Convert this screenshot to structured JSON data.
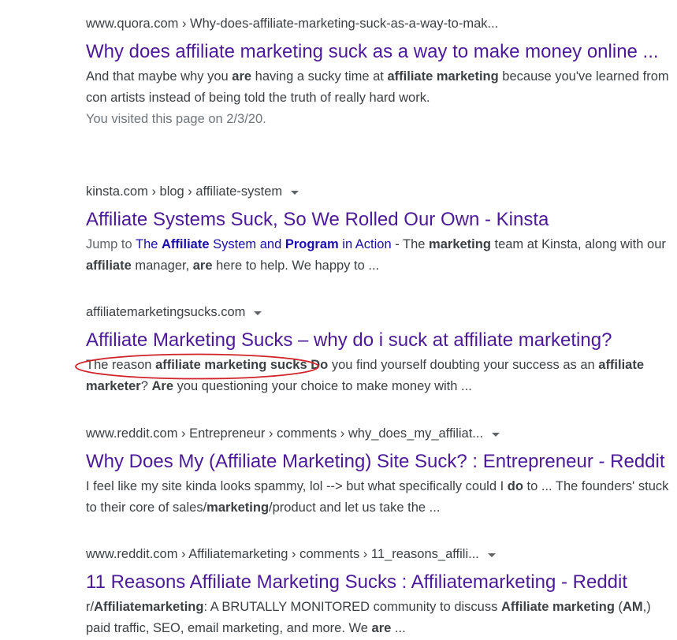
{
  "results": [
    {
      "cite": "www.quora.com › Why-does-affiliate-marketing-suck-as-a-way-to-mak...",
      "title": "Why does affiliate marketing suck as a way to make money online ...",
      "snippet": [
        {
          "t": "And that maybe why you "
        },
        {
          "t": "are",
          "b": true
        },
        {
          "t": " having a sucky time at "
        },
        {
          "t": "affiliate marketing",
          "b": true
        },
        {
          "t": " because you've learned from con artists instead of being told the truth of really hard work."
        }
      ],
      "visited": "You visited this page on 2/3/20."
    },
    {
      "cite": "kinsta.com › blog › affiliate-system",
      "title": "Affiliate Systems Suck, So We Rolled Our Own - Kinsta",
      "jump_prefix": "Jump to ",
      "jump_link": [
        {
          "t": "The "
        },
        {
          "t": "Affiliate",
          "b": true
        },
        {
          "t": " System and "
        },
        {
          "t": "Program",
          "b": true
        },
        {
          "t": " in Action"
        }
      ],
      "snippet": [
        {
          "t": " - The "
        },
        {
          "t": "marketing",
          "b": true
        },
        {
          "t": " team at Kinsta, along with our "
        },
        {
          "t": "affiliate",
          "b": true
        },
        {
          "t": " manager, "
        },
        {
          "t": "are",
          "b": true
        },
        {
          "t": " here to help. We happy to ..."
        }
      ]
    },
    {
      "cite": "affiliatemarketingsucks.com",
      "title": "Affiliate Marketing Sucks – why do i suck at affiliate marketing?",
      "snippet": [
        {
          "t": "The reason "
        },
        {
          "t": "affiliate marketing sucks",
          "b": true
        },
        {
          "t": " "
        },
        {
          "t": "Do",
          "b": true
        },
        {
          "t": " you find yourself doubting your success as an "
        },
        {
          "t": "affiliate marketer",
          "b": true
        },
        {
          "t": "? "
        },
        {
          "t": "Are",
          "b": true
        },
        {
          "t": " you questioning your choice to make money with ..."
        }
      ]
    },
    {
      "cite": "www.reddit.com › Entrepreneur › comments › why_does_my_affiliat...",
      "title": "Why Does My (Affiliate Marketing) Site Suck? : Entrepreneur - Reddit",
      "snippet": [
        {
          "t": "I feel like my site kinda looks spammy, lol --> but what specifically could I "
        },
        {
          "t": "do",
          "b": true
        },
        {
          "t": " to ... The founders' stuck to their core of sales/"
        },
        {
          "t": "marketing",
          "b": true
        },
        {
          "t": "/product and let us take the ..."
        }
      ]
    },
    {
      "cite": "www.reddit.com › Affiliatemarketing › comments › 11_reasons_affili...",
      "title": "11 Reasons Affiliate Marketing Sucks : Affiliatemarketing - Reddit",
      "snippet": [
        {
          "t": "r/"
        },
        {
          "t": "Affiliatemarketing",
          "b": true
        },
        {
          "t": ": A BRUTALLY MONITORED community to discuss "
        },
        {
          "t": "Affiliate marketing",
          "b": true
        },
        {
          "t": " ("
        },
        {
          "t": "AM",
          "b": true
        },
        {
          "t": ",) paid traffic, SEO, email marketing, and more. We "
        },
        {
          "t": "are",
          "b": true
        },
        {
          "t": " ..."
        }
      ]
    }
  ],
  "colors": {
    "title_visited": "#4b1a99",
    "jump_link": "#1a0dab",
    "annotation": "#d0232a"
  },
  "icons": {
    "result_menu": "caret-down-icon",
    "annotation": "red-ellipse-annotation"
  }
}
